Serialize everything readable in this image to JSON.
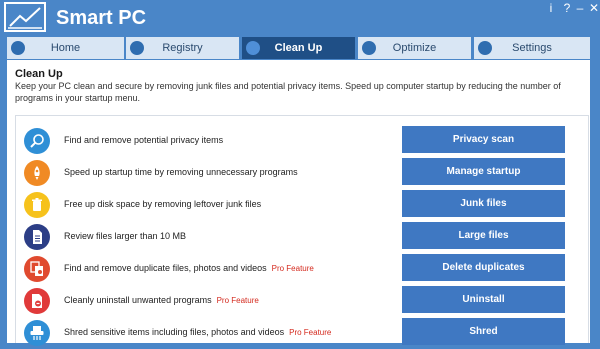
{
  "app": {
    "title": "Smart PC",
    "logo_icon": "line-chart-icon"
  },
  "window_buttons": {
    "help": "?",
    "minimize": "–",
    "close": "✕",
    "info": "i"
  },
  "tabs": [
    {
      "label": "Home",
      "icon": "home-icon"
    },
    {
      "label": "Registry",
      "icon": "registry-icon"
    },
    {
      "label": "Clean Up",
      "icon": "broom-icon",
      "active": true
    },
    {
      "label": "Optimize",
      "icon": "gear-icon"
    },
    {
      "label": "Settings",
      "icon": "wrench-icon"
    }
  ],
  "panel": {
    "title": "Clean Up",
    "description": "Keep your PC clean and secure by removing junk files and potential privacy items. Speed up computer startup by reducing the number of programs in your startup menu."
  },
  "items": [
    {
      "text": "Find and remove potential privacy items",
      "pro": "",
      "button": "Privacy scan",
      "icon": "magnifier-icon",
      "color": "#2f8fd6"
    },
    {
      "text": "Speed up startup time by removing unnecessary programs",
      "pro": "",
      "button": "Manage startup",
      "icon": "rocket-icon",
      "color": "#f08a24"
    },
    {
      "text": "Free up disk space by removing leftover junk files",
      "pro": "",
      "button": "Junk files",
      "icon": "trash-icon",
      "color": "#f6c21c"
    },
    {
      "text": "Review files larger than 10 MB",
      "pro": "",
      "button": "Large files",
      "icon": "document-icon",
      "color": "#2c3e86"
    },
    {
      "text": "Find and remove duplicate files, photos and videos",
      "pro": "Pro Feature",
      "button": "Delete duplicates",
      "icon": "duplicate-files-icon",
      "color": "#e04a2f"
    },
    {
      "text": "Cleanly uninstall unwanted programs",
      "pro": "Pro Feature",
      "button": "Uninstall",
      "icon": "uninstall-icon",
      "color": "#e03a3a"
    },
    {
      "text": "Shred sensitive items including files, photos and videos",
      "pro": "Pro Feature",
      "button": "Shred",
      "icon": "shredder-icon",
      "color": "#2f8fd6"
    }
  ]
}
